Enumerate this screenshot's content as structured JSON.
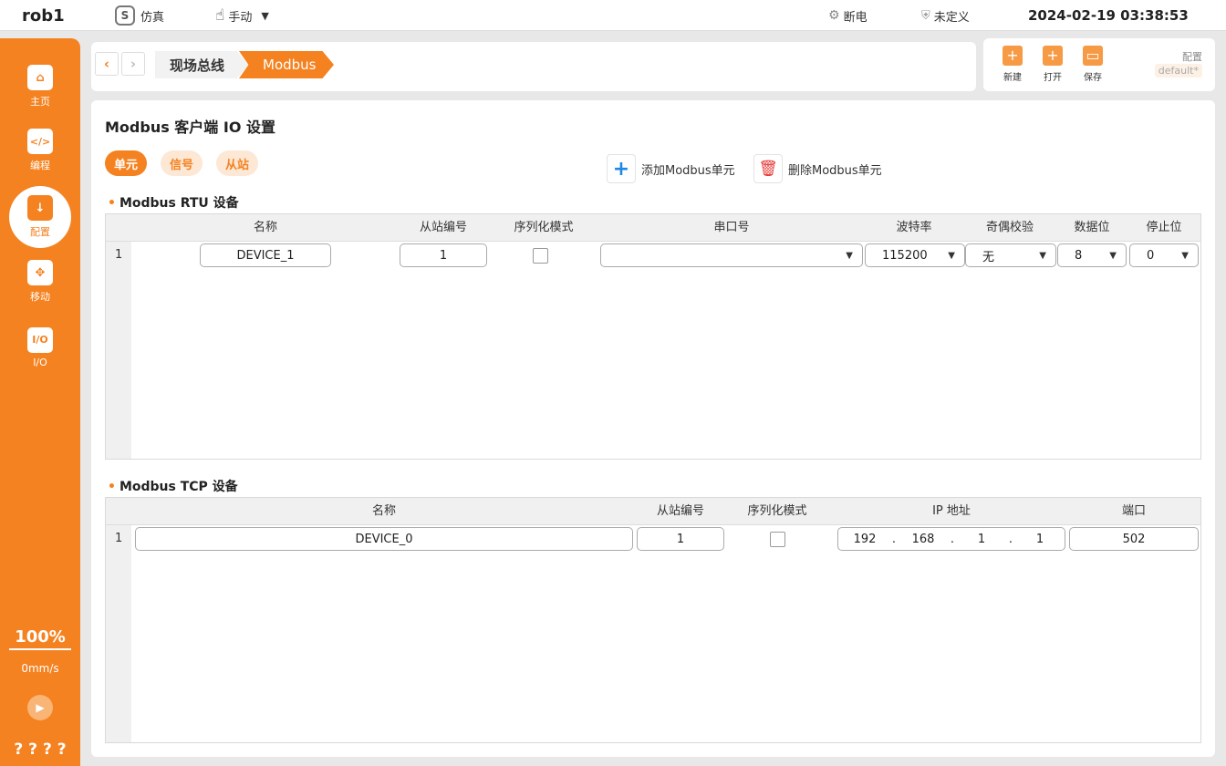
{
  "topbar": {
    "robot": "rob1",
    "sim_label": "仿真",
    "mode_label": "手动",
    "power_label": "断电",
    "safety_label": "未定义",
    "datetime": "2024-02-19 03:38:53"
  },
  "sidebar": {
    "items": [
      {
        "label": "主页",
        "icon": "home-icon"
      },
      {
        "label": "编程",
        "icon": "code-icon"
      },
      {
        "label": "配置",
        "icon": "config-icon"
      },
      {
        "label": "移动",
        "icon": "move-icon"
      },
      {
        "label": "I/O",
        "icon": "io-icon"
      }
    ],
    "speed_percent": "100%",
    "speed": "0mm/s",
    "bottom_text": "? ? ? ?"
  },
  "breadcrumb": {
    "items": [
      "现场总线",
      "Modbus"
    ]
  },
  "file_toolbar": {
    "new_label": "新建",
    "open_label": "打开",
    "save_label": "保存",
    "config_label": "配置",
    "config_name": "default*"
  },
  "page": {
    "title": "Modbus 客户端 IO 设置",
    "tabs": [
      "单元",
      "信号",
      "从站"
    ],
    "add_label": "添加Modbus单元",
    "delete_label": "删除Modbus单元"
  },
  "rtu": {
    "title": "Modbus RTU 设备",
    "headers": [
      "名称",
      "从站编号",
      "序列化模式",
      "串口号",
      "波特率",
      "奇偶校验",
      "数据位",
      "停止位"
    ],
    "rows": [
      {
        "index": "1",
        "name": "DEVICE_1",
        "slave": "1",
        "serialized": false,
        "port": "",
        "baud": "115200",
        "parity": "无",
        "databits": "8",
        "stopbits": "0"
      }
    ]
  },
  "tcp": {
    "title": "Modbus TCP 设备",
    "headers": [
      "名称",
      "从站编号",
      "序列化模式",
      "IP 地址",
      "端口"
    ],
    "rows": [
      {
        "index": "1",
        "name": "DEVICE_0",
        "slave": "1",
        "serialized": false,
        "ip": [
          "192",
          "168",
          "1",
          "1"
        ],
        "port": "502"
      }
    ]
  },
  "colors": {
    "accent": "#f58220",
    "pill_bg": "#fde8d6",
    "delete": "#e53935",
    "add": "#1e88e5"
  }
}
